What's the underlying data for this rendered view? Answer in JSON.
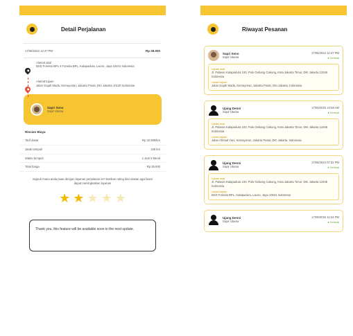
{
  "colors": {
    "accent": "#f7c531",
    "pickup_pin": "#222222",
    "dropoff_pin": "#e74c3c",
    "star_on": "#f3b900",
    "star_off": "#f6e9b8"
  },
  "left": {
    "status_left": "",
    "status_right": "",
    "title": "Detail Perjalanan",
    "date": "17/06/2022 12:47 PM",
    "order_code": "Rp 28.000",
    "pickup": {
      "label": "Alamat asal",
      "address": "BSD Foresta BPL 4 Foresta BPL, Kalapadura, Lacno, Jaya 10041 Indonesia"
    },
    "dropoff": {
      "label": "Alamat tujuan",
      "address": "Jalan Gajah Mada, Kemayoran, Jakarta Pusat, DKI Jakarta 10130 Indonesia"
    },
    "driver": {
      "name": "Sapri Seno",
      "sub": "Sopir Utama"
    },
    "details_title": "Rincian Biaya",
    "details": [
      {
        "label": "Tarif dasar",
        "value": "Rp 22.800/km"
      },
      {
        "label": "Jarak tempuh",
        "value": "150 km"
      },
      {
        "label": "Waktu tempuh",
        "value": "1 Jam 5 Menit"
      },
      {
        "label": "Total harga",
        "value": "Rp 28.000"
      }
    ],
    "notice": "Sejauh mana anda puas dengan layanan perjalanan ini? Berikan rating dan ulasan agar kami dapat meningkatkan layanan",
    "rating": 2,
    "rating_max": 5,
    "feedback": "Thank you, this feature will be available soon in the next update."
  },
  "right": {
    "status_left": "",
    "status_right": "",
    "title": "Riwayat Pesanan",
    "orders": [
      {
        "avatar": "photo",
        "name": "Sapri Seno",
        "sub": "Sopir Utama",
        "date": "17/06/2022 12:47 PM",
        "status": "Selesai",
        "from_label": "Lokasi asal",
        "from": "Jl. Pabean Kalapadura 100, Pulo Gebang Cakung, Kota Jakarta Timur, DKI Jakarta 12345 Indonesia",
        "to_label": "Lokasi tujuan",
        "to": "Jalan Gajah Mada, Kemayoran, Jakarta Pusat, DKI Jakarta, Indonesia"
      },
      {
        "avatar": "icon",
        "name": "Ujang Denni",
        "sub": "Sopir Utama",
        "date": "17/06/2022 10:58 AM",
        "status": "Selesai",
        "from_label": "Lokasi asal",
        "from": "Jl. Pabean Kalapadura 100, Pulo Gebang Cakung, Kota Jakarta Timur, DKI Jakarta 12345 Indonesia",
        "to_label": "Lokasi tujuan",
        "to": "Jalan Ahmad Yani, Kemayoran, Jakarta Pusat, DKI Jakarta, Indonesia"
      },
      {
        "avatar": "icon",
        "name": "Ujang Denni",
        "sub": "Sopir Utama",
        "date": "17/06/2022 07:32 PM",
        "status": "Selesai",
        "from_label": "Lokasi asal",
        "from": "Jl. Pabean Kalapadura 100, Pulo Gebang Cakung, Kota Jakarta Timur, DKI Jakarta 12345 Indonesia",
        "to_label": "Lokasi tujuan",
        "to": "BSD Foresta BPL, Kalapadura, Lacno, Jaya 10041 Indonesia"
      },
      {
        "avatar": "icon",
        "name": "Ujang Denni",
        "sub": "Sopir Utama",
        "date": "17/06/2022 11:24 PM",
        "status": "Selesai"
      }
    ]
  }
}
